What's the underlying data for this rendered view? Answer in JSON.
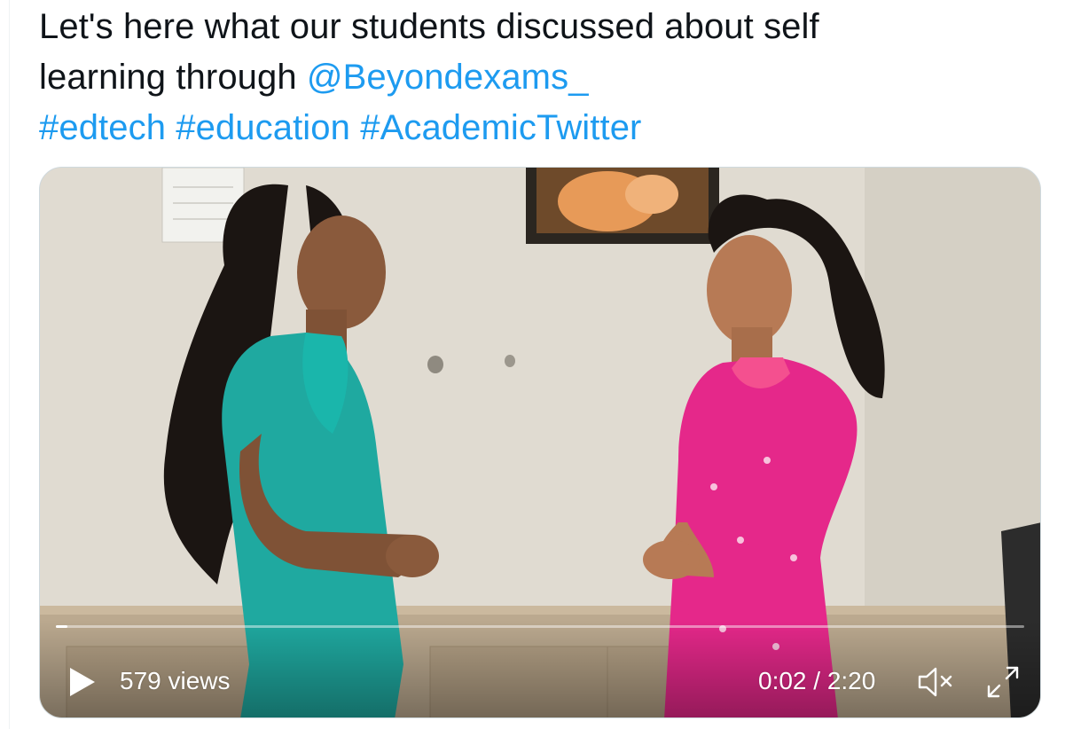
{
  "tweet": {
    "text_line1": "Let's here what our students discussed about self",
    "text_line2_prefix": "learning through ",
    "mention": "@Beyondexams_",
    "hashtags": [
      "#edtech",
      "#education",
      "#AcademicTwitter"
    ]
  },
  "video": {
    "views": "579 views",
    "time": "0:02 / 2:20",
    "progress_fraction": 0.012,
    "play_icon": "play-icon",
    "mute_icon": "volume-muted-icon",
    "fullscreen_icon": "fullscreen-icon"
  },
  "colors": {
    "text": "#0f1419",
    "link": "#1d9bf0",
    "control": "#ffffff"
  }
}
